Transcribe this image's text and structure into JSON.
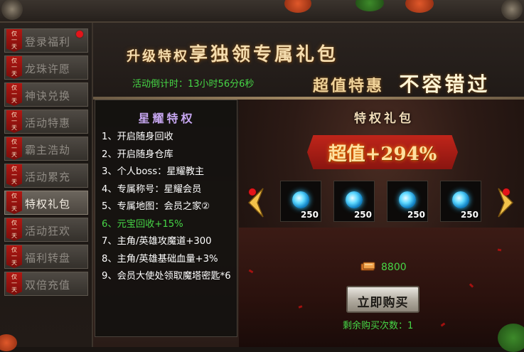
{
  "sidebar": {
    "tag_text": "仅一天",
    "items": [
      {
        "label": "登录福利",
        "active": false,
        "has_dot": true
      },
      {
        "label": "龙珠许愿",
        "active": false,
        "has_dot": false
      },
      {
        "label": "神诀兑换",
        "active": false,
        "has_dot": false
      },
      {
        "label": "活动特惠",
        "active": false,
        "has_dot": false
      },
      {
        "label": "霸主浩劫",
        "active": false,
        "has_dot": false
      },
      {
        "label": "活动累充",
        "active": false,
        "has_dot": false
      },
      {
        "label": "特权礼包",
        "active": true,
        "has_dot": false
      },
      {
        "label": "活动狂欢",
        "active": false,
        "has_dot": false
      },
      {
        "label": "福利转盘",
        "active": false,
        "has_dot": false
      },
      {
        "label": "双倍充值",
        "active": false,
        "has_dot": false
      }
    ]
  },
  "banner": {
    "title_small": "升级特权",
    "title_big": "享独领专属礼包",
    "countdown": "活动倒计时：13小时56分6秒",
    "slogan_small": "超值特惠",
    "slogan_big": "不容错过"
  },
  "privileges": {
    "title": "星耀特权",
    "items": [
      {
        "text": "1、开启随身回收",
        "highlight": false
      },
      {
        "text": "2、开启随身仓库",
        "highlight": false
      },
      {
        "text": "3、个人boss：星耀教主",
        "highlight": false
      },
      {
        "text": "4、专属称号：星耀会员",
        "highlight": false
      },
      {
        "text": "5、专属地图：会员之家②",
        "highlight": false
      },
      {
        "text": "6、元宝回收+15%",
        "highlight": true
      },
      {
        "text": "7、主角/英雄攻魔道+300",
        "highlight": false
      },
      {
        "text": "8、主角/英雄基础血量+3%",
        "highlight": false
      },
      {
        "text": "9、会员大使处领取魔塔密匙*6",
        "highlight": false
      }
    ]
  },
  "gift": {
    "title": "特权礼包",
    "ribbon": "超值+294%",
    "slots": [
      {
        "icon": "blue-gem-icon",
        "count": "250"
      },
      {
        "icon": "blue-gem-icon",
        "count": "250"
      },
      {
        "icon": "blue-gem-icon",
        "count": "250"
      },
      {
        "icon": "blue-gem-icon",
        "count": "250"
      }
    ],
    "price": "8800",
    "buy_label": "立即购买",
    "remaining": "剩余购买次数：1"
  },
  "colors": {
    "accent_green": "#46d646",
    "tag_red": "#b01813",
    "gem_blue": "#36c6ff"
  }
}
